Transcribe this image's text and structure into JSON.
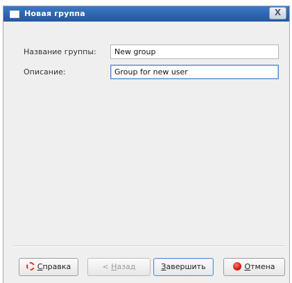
{
  "window": {
    "title": "Новая группа",
    "close_glyph": "X"
  },
  "form": {
    "group_name_label": "Название группы:",
    "group_name_value": "New group",
    "description_label": "Описание:",
    "description_value": "Group for new user"
  },
  "buttons": {
    "help": {
      "label": "Справка",
      "mnemonic": "С",
      "rest": "правка",
      "icon": "help-lifebuoy-icon"
    },
    "back": {
      "label": "< Назад",
      "prefix": "< ",
      "mnemonic": "Н",
      "rest": "азад"
    },
    "finish": {
      "label": "Завершить",
      "mnemonic": "З",
      "rest": "авершить"
    },
    "cancel": {
      "label": "Отмена",
      "mnemonic": "О",
      "rest": "тмена",
      "icon": "cancel-stop-icon"
    }
  },
  "colors": {
    "titlebar": "#2f66b0",
    "focus_border": "#5b8fd1",
    "cancel_icon": "#d11a0c",
    "help_icon": "#d23a2a"
  }
}
